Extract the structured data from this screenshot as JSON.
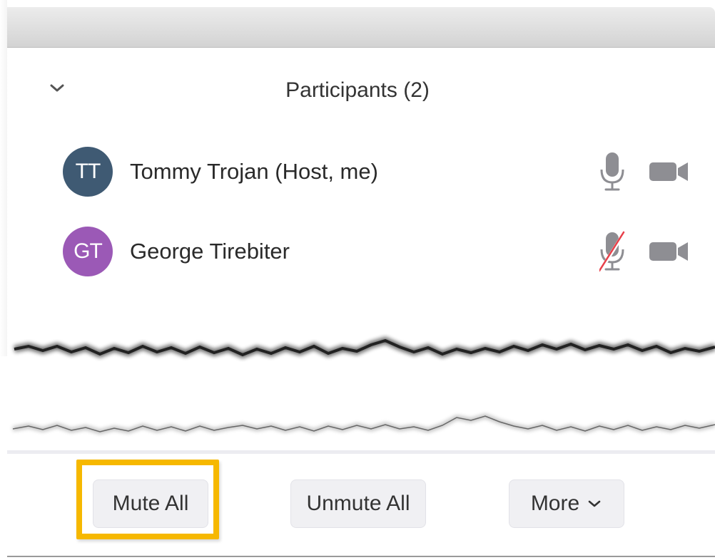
{
  "panel": {
    "title": "Participants (2)"
  },
  "participants": [
    {
      "initials": "TT",
      "name": "Tommy Trojan (Host, me)",
      "avatar_color": "#3f5a73",
      "mic": "on"
    },
    {
      "initials": "GT",
      "name": "George Tirebiter",
      "avatar_color": "#9b59b6",
      "mic": "muted"
    }
  ],
  "footer": {
    "mute_all_label": "Mute All",
    "unmute_all_label": "Unmute All",
    "more_label": "More",
    "more_chevron": "⌄"
  },
  "icons": {
    "collapse": "chevron-down-icon",
    "mic": "microphone-icon",
    "mic_muted": "microphone-muted-icon",
    "camera": "video-camera-icon"
  },
  "colors": {
    "highlight": "#f6b800",
    "muted_slash": "#e8404a",
    "icon_gray": "#8e8e93"
  }
}
